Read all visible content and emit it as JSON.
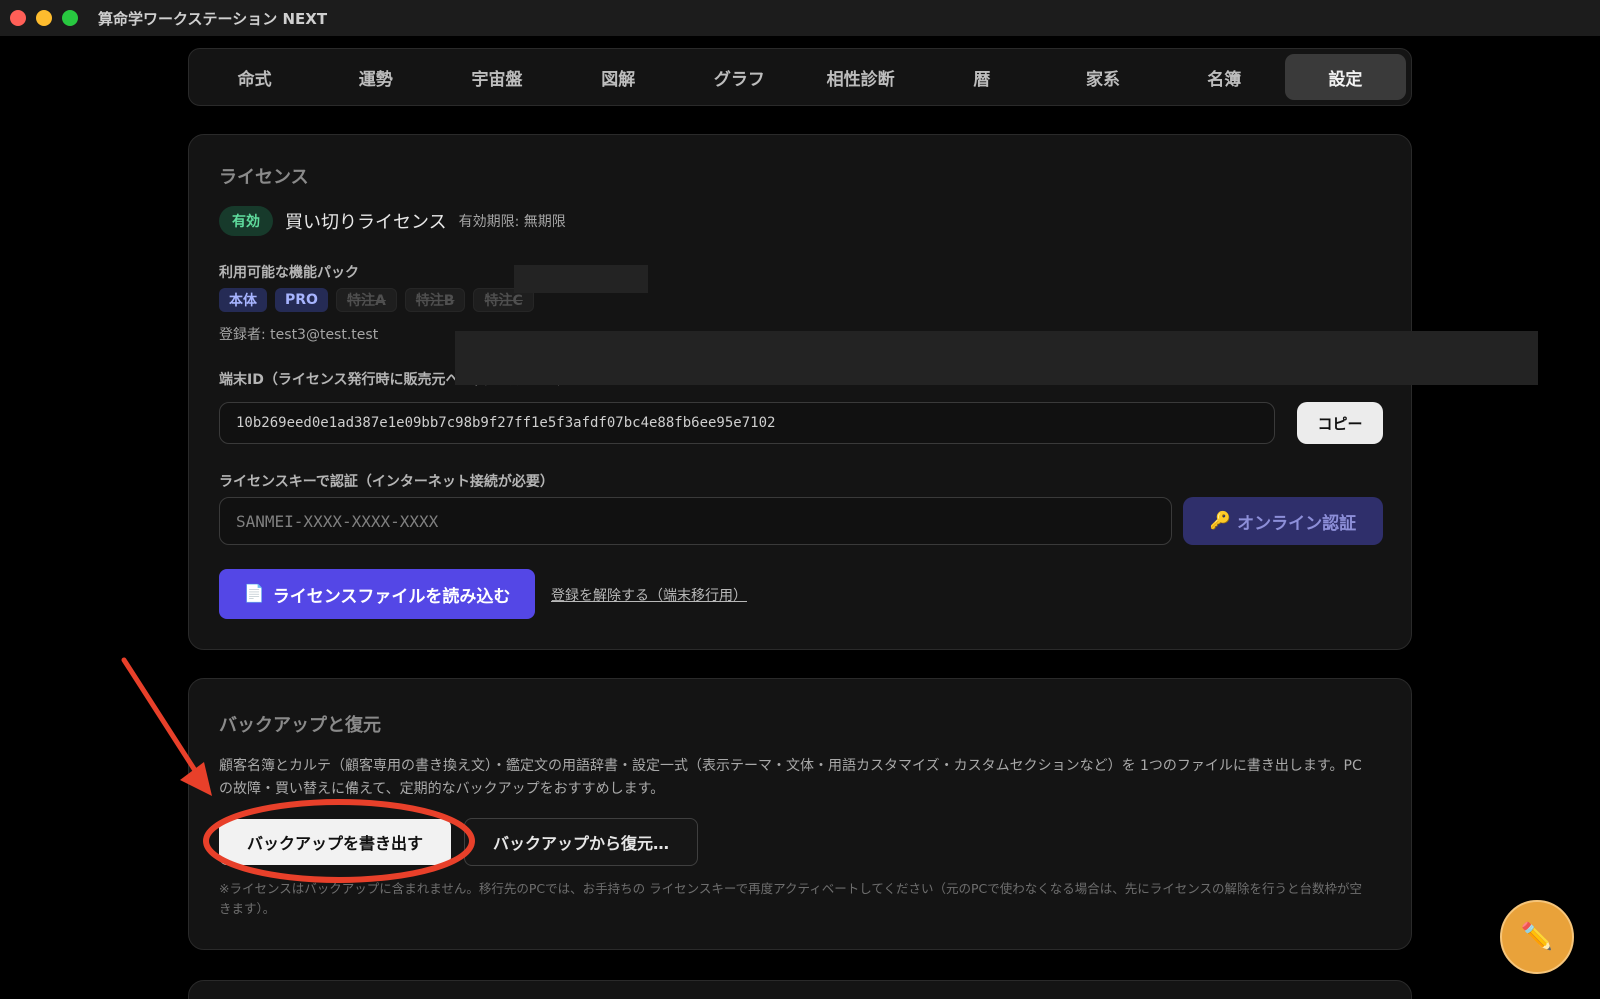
{
  "window": {
    "title": "算命学ワークステーション NEXT"
  },
  "tabs": [
    {
      "label": "命式"
    },
    {
      "label": "運勢"
    },
    {
      "label": "宇宙盤"
    },
    {
      "label": "図解"
    },
    {
      "label": "グラフ"
    },
    {
      "label": "相性診断"
    },
    {
      "label": "暦"
    },
    {
      "label": "家系"
    },
    {
      "label": "名簿"
    },
    {
      "label": "設定",
      "active": true
    }
  ],
  "license": {
    "section_title": "ライセンス",
    "status_badge": "有効",
    "license_type": "買い切りライセンス",
    "expiry": "有効期限: 無期限",
    "packs_label": "利用可能な機能パック",
    "packs": [
      {
        "label": "本体",
        "enabled": true
      },
      {
        "label": "PRO",
        "enabled": true
      },
      {
        "label": "特注A",
        "enabled": false
      },
      {
        "label": "特注B",
        "enabled": false
      },
      {
        "label": "特注C",
        "enabled": false
      }
    ],
    "registrant": "登録者: test3@test.test",
    "device_id_label": "端末ID（ライセンス発行時に販売元へお伝えください）",
    "device_id": "10b269eed0e1ad387e1e09bb7c98b9f27ff1e5f3afdf07bc4e88fb6ee95e7102",
    "copy_button": "コピー",
    "key_label": "ライセンスキーで認証（インターネット接続が必要）",
    "key_placeholder": "SANMEI-XXXX-XXXX-XXXX",
    "online_auth_button": "オンライン認証",
    "load_file_button": "ライセンスファイルを読み込む",
    "unregister_link": "登録を解除する（端末移行用）"
  },
  "backup": {
    "section_title": "バックアップと復元",
    "description": "顧客名簿とカルテ（顧客専用の書き換え文）・鑑定文の用語辞書・設定一式（表示テーマ・文体・用語カスタマイズ・カスタムセクションなど）を 1つのファイルに書き出します。PCの故障・買い替えに備えて、定期的なバックアップをおすすめします。",
    "export_button": "バックアップを書き出す",
    "restore_button": "バックアップから復元…",
    "note": "※ライセンスはバックアップに含まれません。移行先のPCでは、お手持ちの ライセンスキーで再度アクティベートしてください（元のPCで使わなくなる場合は、先にライセンスの解除を行うと台数枠が空きます）。"
  },
  "colors": {
    "accent": "#5447e6",
    "annotation": "#e8402a",
    "fab": "#e9a23a"
  },
  "icons": {
    "key": "🔑",
    "file": "📄",
    "pencil": "✏️"
  }
}
